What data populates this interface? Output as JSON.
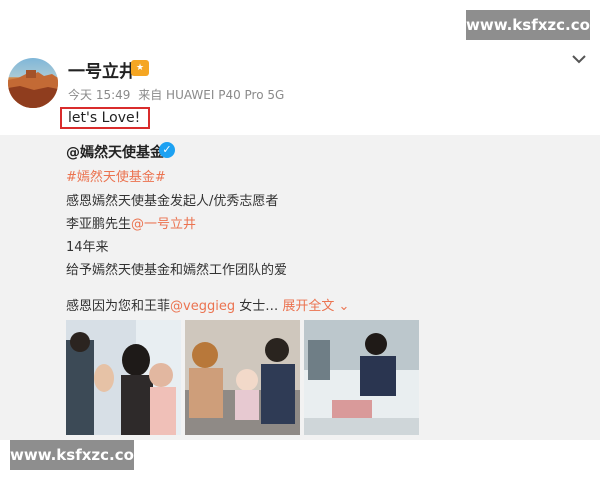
{
  "watermark": {
    "top_right": "www.ksfxzc.com",
    "bottom_left": "www.ksfxzc.com"
  },
  "post": {
    "username": "一号立井",
    "timestamp": "今天 15:49",
    "source": "来自 HUAWEI P40 Pro 5G",
    "text": "let's Love!",
    "badge_icon": "vip-badge-icon",
    "menu_icon": "chevron-down-icon"
  },
  "repost": {
    "author": "@嫣然天使基金",
    "verified_icon": "verified-icon",
    "lines": [
      {
        "text": "#嫣然天使基金#",
        "color": "#eb7350"
      },
      {
        "text": "感恩嫣然天使基金发起人/优秀志愿者"
      },
      {
        "text_prefix": "李亚鹏先生",
        "mention": "@一号立井"
      },
      {
        "text": "14年来"
      },
      {
        "text": "给予嫣然天使基金和嫣然工作团队的爱"
      },
      {
        "text_prefix": "感恩因为您和王菲",
        "mention": "@veggieg",
        "suffix": " 女士…",
        "expand": "展开全文"
      }
    ],
    "photos": [
      {
        "alt": "two people clapping with a child"
      },
      {
        "alt": "family with a baby indoors"
      },
      {
        "alt": "man by a hospital bed"
      }
    ]
  },
  "colors": {
    "accent": "#eb7350",
    "highlight_border": "#d92c2c",
    "repost_bg": "#f2f2f2",
    "watermark_bg": "#8e8e8e"
  }
}
